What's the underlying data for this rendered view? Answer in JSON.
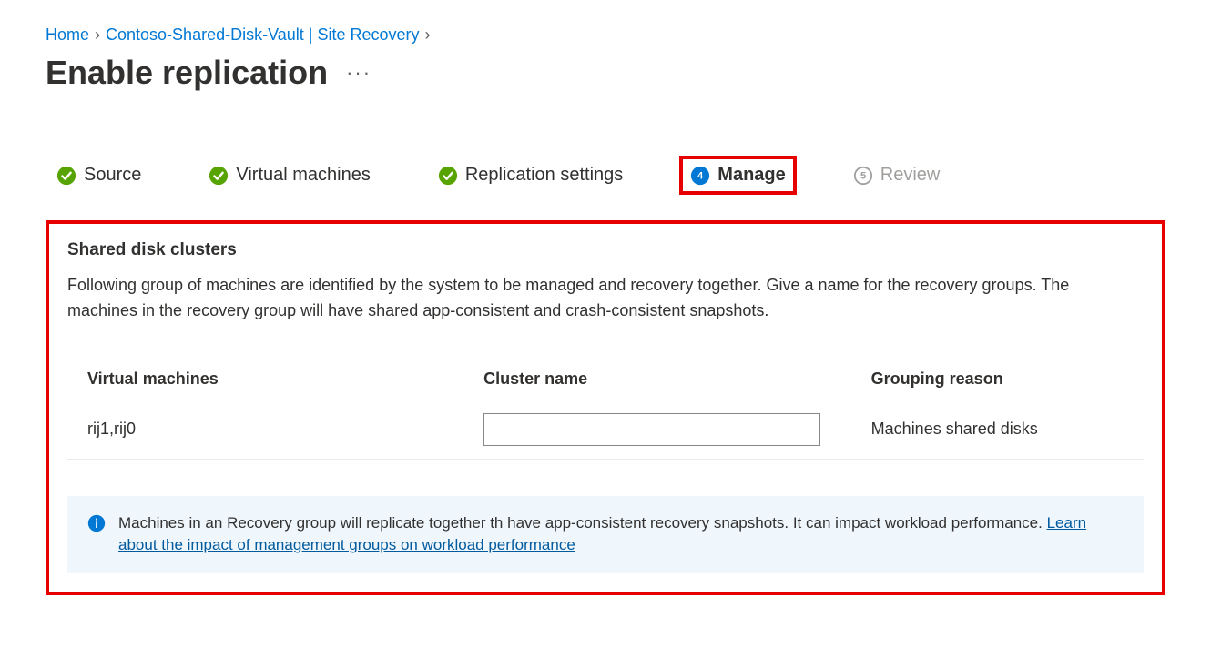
{
  "breadcrumb": {
    "home": "Home",
    "vault": "Contoso-Shared-Disk-Vault | Site Recovery"
  },
  "title": "Enable replication",
  "tabs": {
    "source": "Source",
    "vms": "Virtual machines",
    "replication": "Replication settings",
    "manage_num": "4",
    "manage": "Manage",
    "review_num": "5",
    "review": "Review"
  },
  "panel": {
    "heading": "Shared disk clusters",
    "description": "Following group of machines are identified by the system to be managed and recovery together. Give a name for the recovery groups. The machines in the recovery group will have shared app-consistent and crash-consistent snapshots.",
    "columns": {
      "vms": "Virtual machines",
      "cluster": "Cluster name",
      "reason": "Grouping reason"
    },
    "rows": [
      {
        "vms": "rij1,rij0",
        "cluster_value": "",
        "reason": "Machines shared disks"
      }
    ],
    "info_text": "Machines in an Recovery group will replicate together th have app-consistent recovery snapshots. It can impact workload performance. ",
    "info_link": "Learn about the impact of management groups on workload performance"
  }
}
